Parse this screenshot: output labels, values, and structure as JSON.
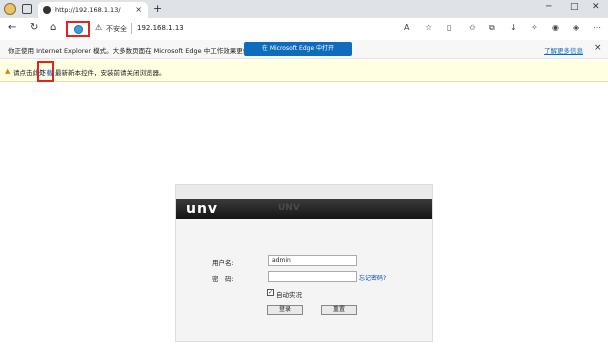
{
  "browser": {
    "tab_title": "http://192.168.1.13/",
    "new_tab": "+",
    "window_controls": [
      "minimize-icon",
      "maximize-icon",
      "close-icon"
    ],
    "security_label": "不安全",
    "url": "192.168.1.13"
  },
  "ie_mode_bar": {
    "message": "你正使用 Internet Explorer 模式。大多数页面在 Microsoft Edge 中工作效果更佳。",
    "open_in_edge": "在 Microsoft Edge 中打开",
    "learn_more": "了解更多信息"
  },
  "info_bar": {
    "prefix": "请点击此处",
    "download_link": "下载",
    "suffix": "最新新本控件，安装前请关闭浏览器。"
  },
  "login": {
    "logo": "unv",
    "watermark": "UNV",
    "username_label": "用户名:",
    "username_value": "admin",
    "password_label": "密　码:",
    "forgot_password": "忘记密码?",
    "remember_check": "✓",
    "remember_label": "自动实况",
    "login_button": "登录",
    "reset_button": "重置"
  }
}
